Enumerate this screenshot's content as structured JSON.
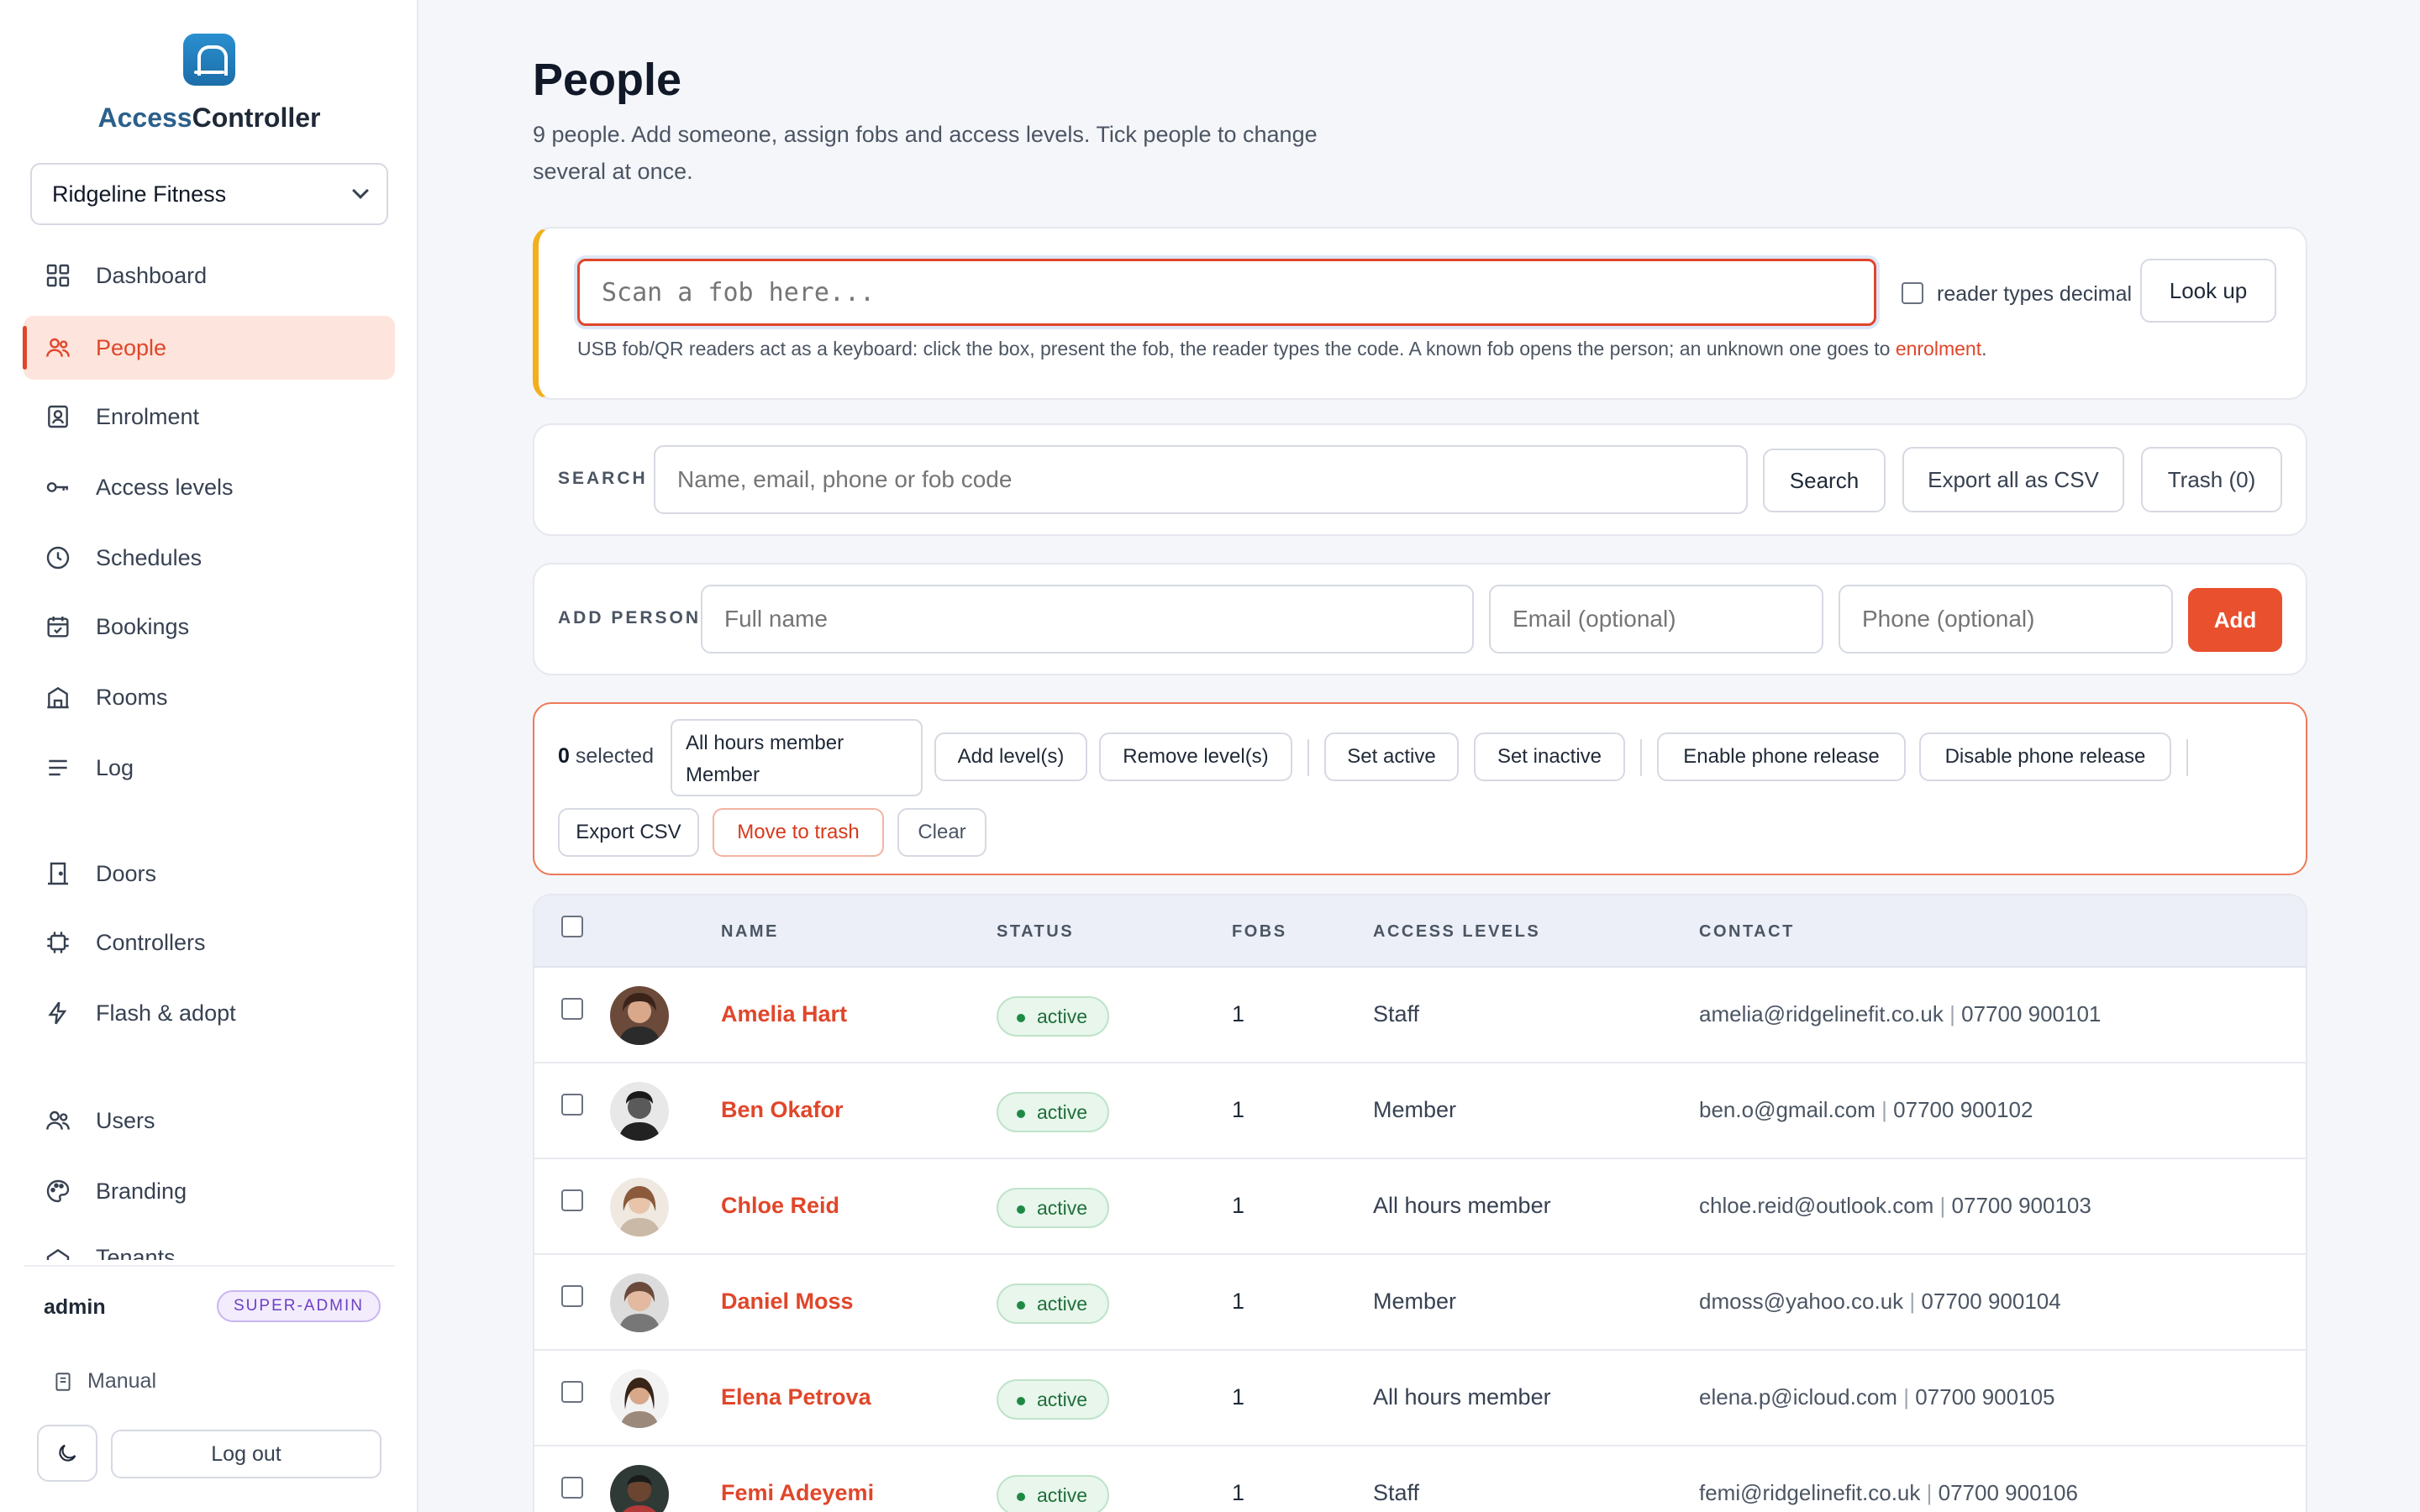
{
  "app": {
    "brand_prefix": "Access",
    "brand_suffix": "Controller",
    "tenant": "Ridgeline Fitness"
  },
  "nav": {
    "items": [
      {
        "label": "Dashboard",
        "icon": "grid-icon"
      },
      {
        "label": "People",
        "icon": "people-icon",
        "active": true
      },
      {
        "label": "Enrolment",
        "icon": "id-badge-icon"
      },
      {
        "label": "Access levels",
        "icon": "key-icon"
      },
      {
        "label": "Schedules",
        "icon": "clock-icon"
      },
      {
        "label": "Bookings",
        "icon": "calendar-icon"
      },
      {
        "label": "Rooms",
        "icon": "room-icon"
      },
      {
        "label": "Log",
        "icon": "list-icon"
      },
      {
        "label": "Doors",
        "icon": "door-icon"
      },
      {
        "label": "Controllers",
        "icon": "chip-icon"
      },
      {
        "label": "Flash & adopt",
        "icon": "bolt-icon"
      },
      {
        "label": "Users",
        "icon": "users-icon"
      },
      {
        "label": "Branding",
        "icon": "palette-icon"
      },
      {
        "label": "Tenants",
        "icon": "building-icon"
      }
    ]
  },
  "user": {
    "name": "admin",
    "role": "SUPER-ADMIN"
  },
  "footer": {
    "manual": "Manual",
    "logout": "Log out"
  },
  "page": {
    "title": "People",
    "subtitle": "9 people. Add someone, assign fobs and access levels. Tick people to change several at once."
  },
  "scan": {
    "placeholder": "Scan a fob here...",
    "decimal_label": "reader types decimal",
    "lookup": "Look up",
    "help": "USB fob/QR readers act as a keyboard: click the box, present the fob, the reader types the code. A known fob opens the person; an unknown one goes to ",
    "help_link": "enrolment",
    "help_end": "."
  },
  "search": {
    "label": "SEARCH",
    "placeholder": "Name, email, phone or fob code",
    "button": "Search",
    "export": "Export all as CSV",
    "trash": "Trash (0)"
  },
  "add_person": {
    "label": "ADD PERSON",
    "name_placeholder": "Full name",
    "email_placeholder": "Email (optional)",
    "phone_placeholder": "Phone (optional)",
    "button": "Add"
  },
  "bulk": {
    "count": "0",
    "selected_label": "selected",
    "level_options": [
      "All hours member",
      "Member"
    ],
    "add_levels": "Add level(s)",
    "remove_levels": "Remove level(s)",
    "set_active": "Set active",
    "set_inactive": "Set inactive",
    "enable_phone": "Enable phone release",
    "disable_phone": "Disable phone release",
    "export_csv": "Export CSV",
    "move_to_trash": "Move to trash",
    "clear": "Clear"
  },
  "table": {
    "headers": {
      "name": "NAME",
      "status": "STATUS",
      "fobs": "FOBS",
      "levels": "ACCESS LEVELS",
      "contact": "CONTACT"
    },
    "rows": [
      {
        "name": "Amelia Hart",
        "status": "active",
        "fobs": "1",
        "levels": "Staff",
        "email": "amelia@ridgelinefit.co.uk",
        "phone": "07700 900101"
      },
      {
        "name": "Ben Okafor",
        "status": "active",
        "fobs": "1",
        "levels": "Member",
        "email": "ben.o@gmail.com",
        "phone": "07700 900102"
      },
      {
        "name": "Chloe Reid",
        "status": "active",
        "fobs": "1",
        "levels": "All hours member",
        "email": "chloe.reid@outlook.com",
        "phone": "07700 900103"
      },
      {
        "name": "Daniel Moss",
        "status": "active",
        "fobs": "1",
        "levels": "Member",
        "email": "dmoss@yahoo.co.uk",
        "phone": "07700 900104"
      },
      {
        "name": "Elena Petrova",
        "status": "active",
        "fobs": "1",
        "levels": "All hours member",
        "email": "elena.p@icloud.com",
        "phone": "07700 900105"
      },
      {
        "name": "Femi Adeyemi",
        "status": "active",
        "fobs": "1",
        "levels": "Staff",
        "email": "femi@ridgelinefit.co.uk",
        "phone": "07700 900106"
      }
    ]
  },
  "colors": {
    "accent": "#e0462a",
    "active_green": "#1f8a45",
    "warning_bar": "#f2b01e"
  }
}
